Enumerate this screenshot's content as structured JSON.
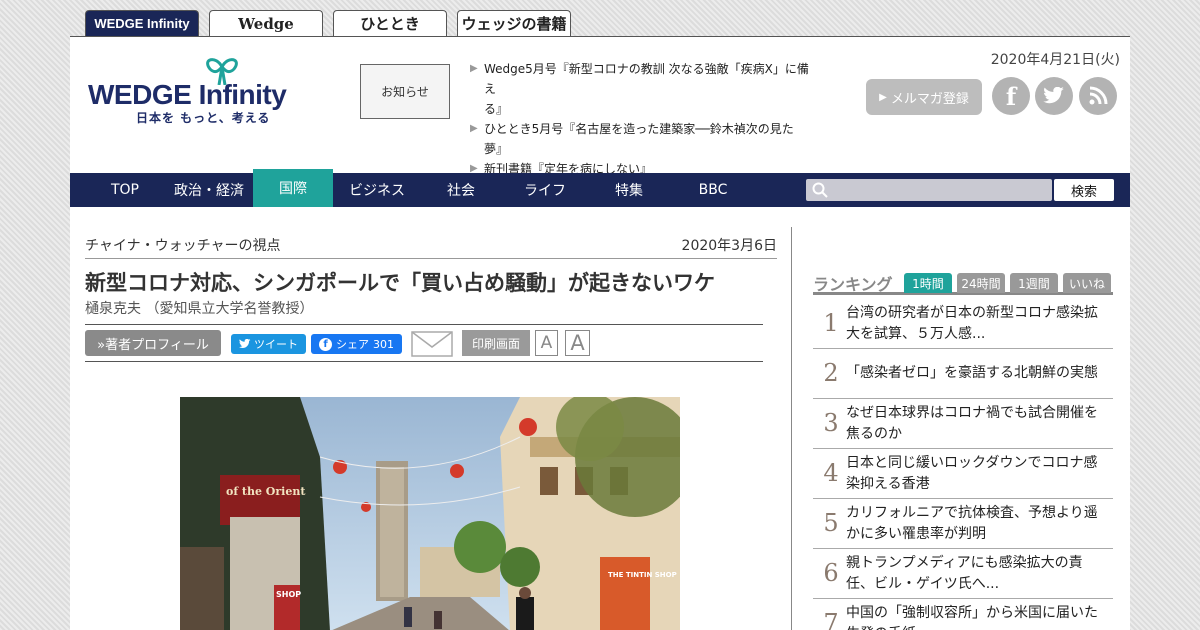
{
  "site_tabs": [
    "WEDGE Infinity",
    "Wedge",
    "ひととき",
    "ウェッジの書籍"
  ],
  "header": {
    "logo_main_a": "WEDGE",
    "logo_main_b": "Infinity",
    "logo_sub": "日本を もっと、考える",
    "notice_label": "お知らせ",
    "news": [
      "Wedge5月号『新型コロナの教訓 次なる強敵「疾病X」に備え",
      "る』",
      "ひととき5月号『名古屋を造った建築家──鈴木禎次の見た",
      "夢』",
      "新刊書籍『定年を病にしない』"
    ],
    "date": "2020年4月21日(火)",
    "mag_button": "メルマガ登録",
    "mag_arrow": "▶",
    "social": [
      "f",
      "t",
      "rss"
    ]
  },
  "nav": {
    "items": [
      "TOP",
      "政治・経済",
      "国際",
      "ビジネス",
      "社会",
      "ライフ",
      "特集",
      "BBC"
    ],
    "active_index": 2,
    "search_placeholder": "",
    "search_button": "検索"
  },
  "article": {
    "category": "チャイナ・ウォッチャーの視点",
    "date": "2020年3月6日",
    "title": "新型コロナ対応、シンガポールで「買い占め騒動」が起きないワケ",
    "author": "樋泉克夫 （愛知県立大学名誉教授）",
    "profile_button": "»著者プロフィール",
    "tweet_button": "ツイート",
    "share_button": "シェア",
    "share_count": "301",
    "print_button": "印刷画面",
    "font_small": "A",
    "font_large": "A",
    "photo_signs": [
      "of the Orient",
      "THE TINTIN SHOP",
      "SHOP"
    ]
  },
  "ranking": {
    "title": "ランキング",
    "tabs": [
      "1時間",
      "24時間",
      "1週間",
      "いいね"
    ],
    "active_tab": 0,
    "items": [
      {
        "num": "1",
        "text": "台湾の研究者が日本の新型コロナ感染拡大を試算、５万人感..."
      },
      {
        "num": "2",
        "text": "「感染者ゼロ」を豪語する北朝鮮の実態"
      },
      {
        "num": "3",
        "text": "なぜ日本球界はコロナ禍でも試合開催を焦るのか"
      },
      {
        "num": "4",
        "text": "日本と同じ緩いロックダウンでコロナ感染抑える香港"
      },
      {
        "num": "5",
        "text": "カリフォルニアで抗体検査、予想より遥かに多い罹患率が判明"
      },
      {
        "num": "6",
        "text": "親トランプメディアにも感染拡大の責任、ビル・ゲイツ氏へ..."
      },
      {
        "num": "7",
        "text": "中国の「強制収容所」から米国に届いた生発の手紙"
      }
    ]
  }
}
